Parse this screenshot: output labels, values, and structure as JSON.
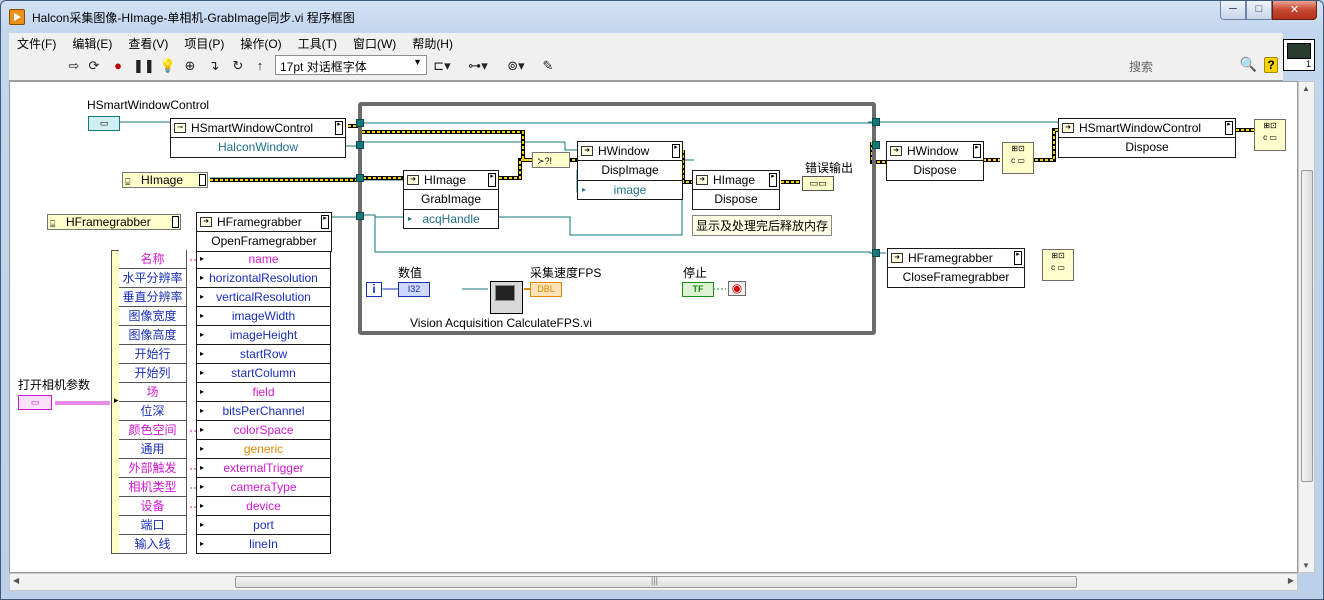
{
  "window": {
    "title": "Halcon采集图像-HImage-单相机-GrabImage同步.vi 程序框图",
    "min": "─",
    "max": "□",
    "close": "✕"
  },
  "menu": [
    "文件(F)",
    "编辑(E)",
    "查看(V)",
    "项目(P)",
    "操作(O)",
    "工具(T)",
    "窗口(W)",
    "帮助(H)"
  ],
  "toolbar": {
    "font": "17pt 对话框字体",
    "search_placeholder": "搜索",
    "help": "?"
  },
  "vi_icon": {
    "number": "1"
  },
  "diagram": {
    "labels": {
      "smart_window_control": "HSmartWindowControl",
      "open_camera_params": "打开相机参数",
      "value": "数值",
      "fps": "采集速度FPS",
      "stop": "停止",
      "error_out": "错误输出",
      "calc_fps": "Vision Acquisition CalculateFPS.vi"
    },
    "note": "显示及处理完后释放内存",
    "constants": {
      "himage": "HImage",
      "hframegrabber": "HFramegrabber",
      "i32": "I32",
      "dbl": "DBL",
      "tf": "TF",
      "iter": "i"
    },
    "nodes": {
      "smart_window_ctrl": {
        "class": "HSmartWindowControl",
        "prop": "HalconWindow"
      },
      "grab_image": {
        "class": "HImage",
        "method": "GrabImage",
        "param": "acqHandle"
      },
      "disp_image": {
        "class": "HWindow",
        "method": "DispImage",
        "param": "image"
      },
      "himage_dispose": {
        "class": "HImage",
        "method": "Dispose"
      },
      "hwindow_dispose": {
        "class": "HWindow",
        "method": "Dispose"
      },
      "smart_dispose": {
        "class": "HSmartWindowControl",
        "method": "Dispose"
      },
      "open_framegrabber": {
        "class": "HFramegrabber",
        "method": "OpenFramegrabber"
      },
      "close_framegrabber": {
        "class": "HFramegrabber",
        "method": "CloseFramegrabber"
      }
    },
    "params": [
      {
        "label": "名称",
        "name": "name"
      },
      {
        "label": "水平分辨率",
        "name": "horizontalResolution"
      },
      {
        "label": "垂直分辨率",
        "name": "verticalResolution"
      },
      {
        "label": "图像宽度",
        "name": "imageWidth"
      },
      {
        "label": "图像高度",
        "name": "imageHeight"
      },
      {
        "label": "开始行",
        "name": "startRow"
      },
      {
        "label": "开始列",
        "name": "startColumn"
      },
      {
        "label": "场",
        "name": "field"
      },
      {
        "label": "位深",
        "name": "bitsPerChannel"
      },
      {
        "label": "颜色空间",
        "name": "colorSpace"
      },
      {
        "label": "通用",
        "name": "generic"
      },
      {
        "label": "外部触发",
        "name": "externalTrigger"
      },
      {
        "label": "相机类型",
        "name": "cameraType"
      },
      {
        "label": "设备",
        "name": "device"
      },
      {
        "label": "端口",
        "name": "port"
      },
      {
        "label": "输入线",
        "name": "lineIn"
      }
    ]
  }
}
